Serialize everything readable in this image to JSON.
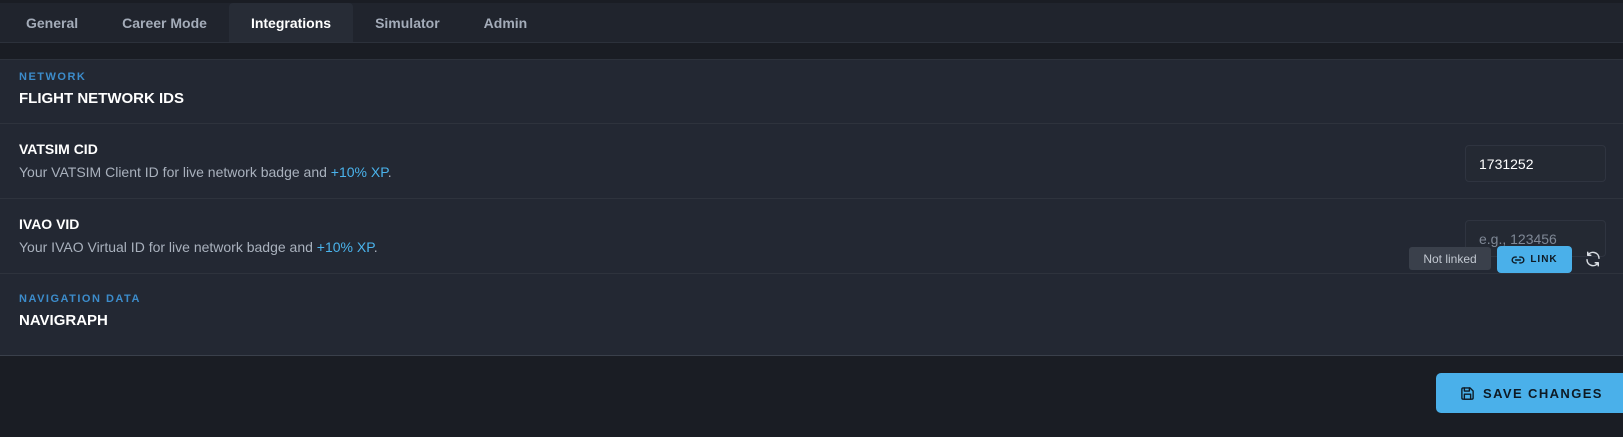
{
  "tabs": [
    {
      "label": "General"
    },
    {
      "label": "Career Mode"
    },
    {
      "label": "Integrations",
      "active": true
    },
    {
      "label": "Simulator"
    },
    {
      "label": "Admin"
    }
  ],
  "network": {
    "overline": "NETWORK",
    "title": "FLIGHT NETWORK IDS",
    "vatsim": {
      "label": "VATSIM CID",
      "desc_prefix": "Your VATSIM Client ID for live network badge and ",
      "desc_xp": "+10% XP",
      "desc_suffix": ".",
      "value": "1731252",
      "placeholder": ""
    },
    "ivao": {
      "label": "IVAO VID",
      "desc_prefix": "Your IVAO Virtual ID for live network badge and ",
      "desc_xp": "+10% XP",
      "desc_suffix": ".",
      "value": "",
      "placeholder": "e.g., 123456"
    }
  },
  "navigation": {
    "overline": "NAVIGATION DATA",
    "title": "NAVIGRAPH",
    "status": "Not linked",
    "link_label": "LINK",
    "refresh_icon": "refresh-icon"
  },
  "footer": {
    "save_label": "SAVE CHANGES",
    "save_icon": "floppy-disk-icon"
  },
  "colors": {
    "background": "#1a1d24",
    "panel": "#232833",
    "accent": "#4ab0ea",
    "overline": "#3c8ccb",
    "xp": "#4ab3ec"
  }
}
